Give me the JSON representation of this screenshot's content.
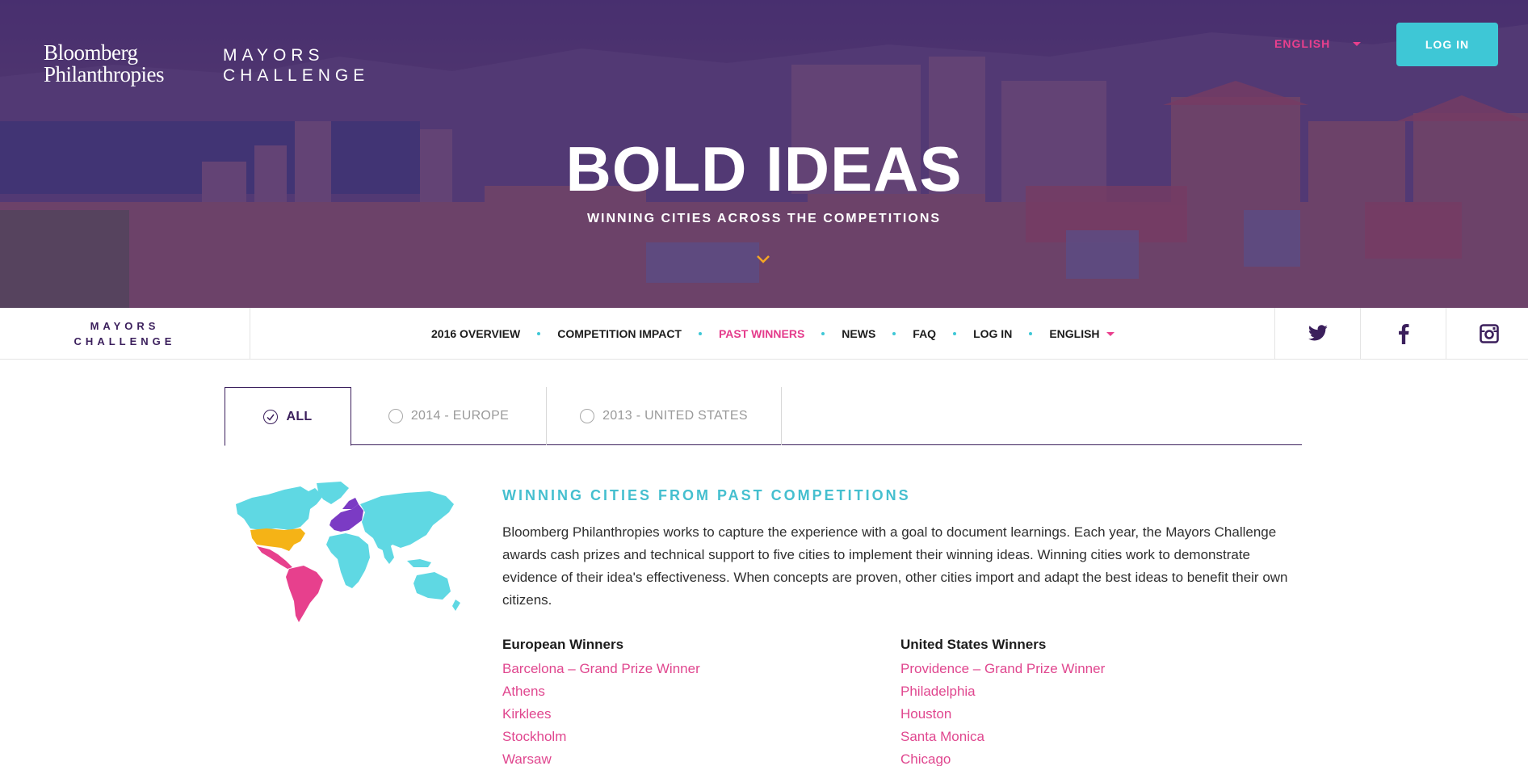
{
  "header": {
    "brand_name": "Bloomberg Philanthropies",
    "brand_line1": "Bloomberg",
    "brand_line2": "Philanthropies",
    "program_line1": "MAYORS",
    "program_line2": "CHALLENGE",
    "language": "ENGLISH",
    "login_label": "LOG IN"
  },
  "hero": {
    "title": "BOLD IDEAS",
    "subtitle": "WINNING CITIES ACROSS THE COMPETITIONS",
    "scroll_icon": "chevron-down-icon"
  },
  "nav": {
    "brand_line1": "MAYORS",
    "brand_line2": "CHALLENGE",
    "items": [
      {
        "label": "2016 OVERVIEW",
        "active": false
      },
      {
        "label": "COMPETITION IMPACT",
        "active": false
      },
      {
        "label": "PAST WINNERS",
        "active": true
      },
      {
        "label": "NEWS",
        "active": false
      },
      {
        "label": "FAQ",
        "active": false
      },
      {
        "label": "LOG IN",
        "active": false
      }
    ],
    "language": "ENGLISH",
    "social": [
      "twitter-icon",
      "facebook-icon",
      "instagram-icon"
    ]
  },
  "tabs": [
    {
      "label": "ALL",
      "selected": true
    },
    {
      "label": "2014 - EUROPE",
      "selected": false
    },
    {
      "label": "2013 - UNITED STATES",
      "selected": false
    }
  ],
  "content": {
    "heading": "WINNING CITIES FROM PAST COMPETITIONS",
    "intro": "Bloomberg Philanthropies works to capture the experience with a goal to document learnings. Each year, the Mayors Challenge awards cash prizes and technical support to five cities to implement their winning ideas. Winning cities work to demonstrate evidence of their idea's effectiveness. When concepts are proven, other cities import and adapt the best ideas to benefit their own citizens.",
    "european": {
      "title": "European Winners",
      "cities": [
        "Barcelona – Grand Prize Winner",
        "Athens",
        "Kirklees",
        "Stockholm",
        "Warsaw"
      ]
    },
    "us": {
      "title": "United States Winners",
      "cities": [
        "Providence – Grand Prize Winner",
        "Philadelphia",
        "Houston",
        "Santa Monica",
        "Chicago"
      ]
    }
  },
  "colors": {
    "accent_teal": "#3ec7d6",
    "accent_pink": "#e43b8b",
    "brand_purple": "#3b1f5c",
    "map_north_america": "#f5b316",
    "map_europe": "#7b3bc4",
    "map_south_america": "#e7408d",
    "map_other": "#5fd8e3"
  }
}
